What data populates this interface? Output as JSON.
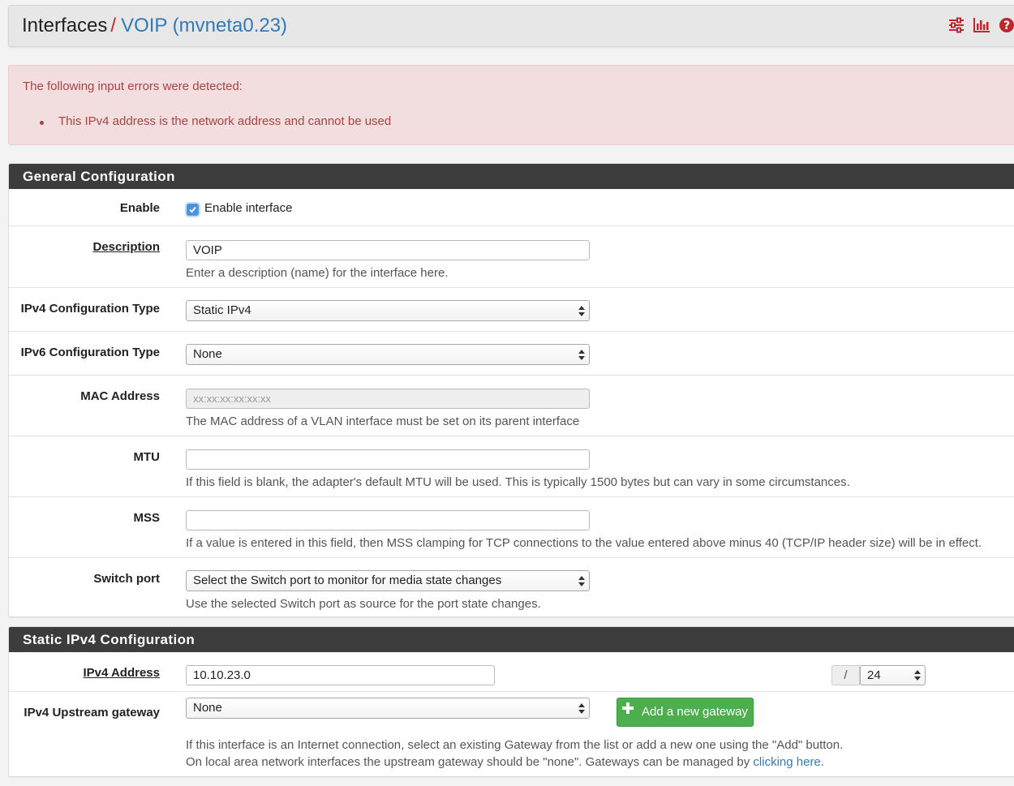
{
  "header": {
    "breadcrumb_root": "Interfaces",
    "separator": "/",
    "breadcrumb_current": "VOIP (mvneta0.23)",
    "icons": [
      "settings-sliders-icon",
      "bar-chart-icon",
      "help-icon"
    ]
  },
  "alert": {
    "title": "The following input errors were detected:",
    "errors": [
      "This IPv4 address is the network address and cannot be used"
    ]
  },
  "general": {
    "heading": "General Configuration",
    "enable": {
      "label": "Enable",
      "checkbox_label": "Enable interface",
      "checked": true
    },
    "description": {
      "label": "Description",
      "value": "VOIP",
      "help": "Enter a description (name) for the interface here."
    },
    "ipv4_type": {
      "label": "IPv4 Configuration Type",
      "value": "Static IPv4"
    },
    "ipv6_type": {
      "label": "IPv6 Configuration Type",
      "value": "None"
    },
    "mac": {
      "label": "MAC Address",
      "placeholder": "xx:xx:xx:xx:xx:xx",
      "help": "The MAC address of a VLAN interface must be set on its parent interface"
    },
    "mtu": {
      "label": "MTU",
      "value": "",
      "help": "If this field is blank, the adapter's default MTU will be used. This is typically 1500 bytes but can vary in some circumstances."
    },
    "mss": {
      "label": "MSS",
      "value": "",
      "help": "If a value is entered in this field, then MSS clamping for TCP connections to the value entered above minus 40 (TCP/IP header size) will be in effect."
    },
    "switch_port": {
      "label": "Switch port",
      "value": "Select the Switch port to monitor for media state changes",
      "help": "Use the selected Switch port as source for the port state changes."
    }
  },
  "static_ipv4": {
    "heading": "Static IPv4 Configuration",
    "address": {
      "label": "IPv4 Address",
      "value": "10.10.23.0",
      "slash": "/",
      "cidr": "24"
    },
    "gateway": {
      "label": "IPv4 Upstream gateway",
      "value": "None",
      "add_button": "Add a new gateway",
      "help_line1": "If this interface is an Internet connection, select an existing Gateway from the list or add a new one using the \"Add\" button.",
      "help_line2_prefix": "On local area network interfaces the upstream gateway should be \"none\". Gateways can be managed by",
      "help_link": "clicking here",
      "help_suffix": "."
    }
  },
  "colors": {
    "accent_red": "#c0272d",
    "link_blue": "#337ab7",
    "panel_heading": "#3c3c3c",
    "success_green": "#4cae4c",
    "alert_bg": "#f2dede",
    "alert_text": "#a94442"
  }
}
